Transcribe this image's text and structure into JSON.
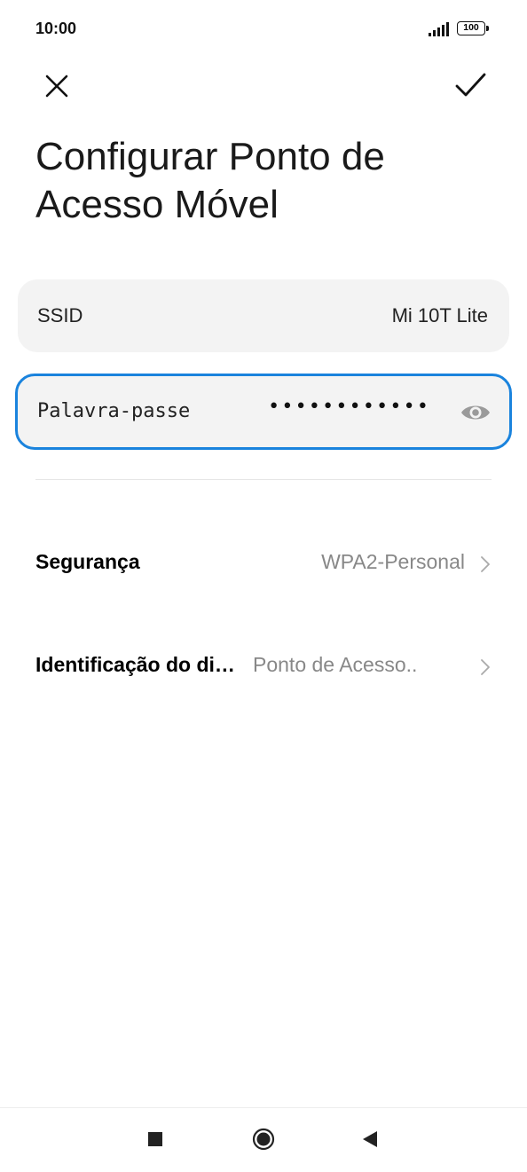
{
  "status_bar": {
    "time": "10:00",
    "battery_level": "100",
    "signal_icon": "signal-bars-icon",
    "battery_icon": "battery-icon"
  },
  "toolbar": {
    "close_icon": "close-icon",
    "confirm_icon": "check-icon"
  },
  "header": {
    "title": "Configurar Ponto de Acesso Móvel"
  },
  "ssid": {
    "label": "SSID",
    "value": "Mi 10T Lite"
  },
  "password": {
    "label": "Palavra-passe",
    "masked_value": "••••••••••••",
    "visibility_icon": "eye-icon"
  },
  "settings": {
    "security": {
      "label": "Segurança",
      "value": "WPA2-Personal"
    },
    "device_identification": {
      "label": "Identificação do di…",
      "value": "Ponto de Acesso.."
    }
  },
  "nav_bar": {
    "recents_icon": "square-icon",
    "home_icon": "circle-icon",
    "back_icon": "triangle-back-icon"
  },
  "colors": {
    "accent": "#1a83dd",
    "card_background": "#f3f3f3",
    "secondary_text": "#888888"
  }
}
